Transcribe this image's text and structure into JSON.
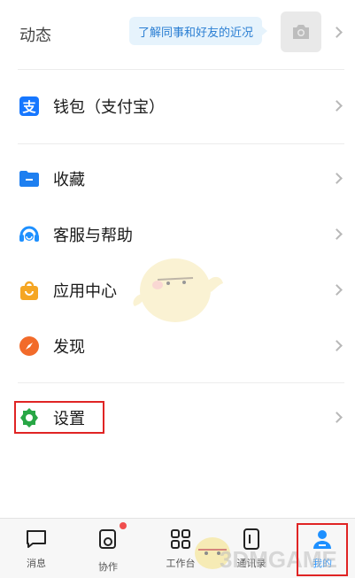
{
  "dynamic": {
    "label": "动态",
    "hint": "了解同事和好友的近况"
  },
  "menu": [
    {
      "label": "钱包（支付宝）",
      "icon": "alipay-icon"
    },
    {
      "label": "收藏",
      "icon": "folder-icon"
    },
    {
      "label": "客服与帮助",
      "icon": "headset-icon"
    },
    {
      "label": "应用中心",
      "icon": "bag-icon"
    },
    {
      "label": "发现",
      "icon": "compass-icon"
    },
    {
      "label": "设置",
      "icon": "gear-icon"
    }
  ],
  "tabs": [
    {
      "label": "消息",
      "icon": "chat-icon",
      "active": false
    },
    {
      "label": "协作",
      "icon": "collab-icon",
      "active": false,
      "badge": true
    },
    {
      "label": "工作台",
      "icon": "grid-icon",
      "active": false
    },
    {
      "label": "通讯录",
      "icon": "contacts-icon",
      "active": false
    },
    {
      "label": "我的",
      "icon": "profile-icon",
      "active": true
    }
  ],
  "watermark": "3DMGAME",
  "colors": {
    "accent": "#1e90ff",
    "highlight": "#e02424",
    "alipay": "#1677ff",
    "folder": "#1e7ff0",
    "headset": "#1e90ff",
    "bag": "#f5a623",
    "compass": "#f26b2a",
    "gear": "#28a745"
  }
}
